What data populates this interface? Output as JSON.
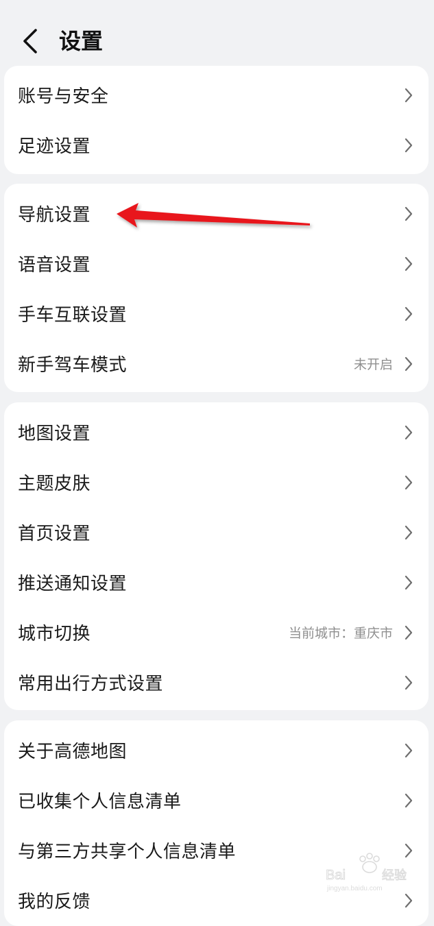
{
  "header": {
    "title": "设置"
  },
  "groups": [
    {
      "items": [
        {
          "label": "账号与安全",
          "value": ""
        },
        {
          "label": "足迹设置",
          "value": ""
        }
      ]
    },
    {
      "items": [
        {
          "label": "导航设置",
          "value": ""
        },
        {
          "label": "语音设置",
          "value": ""
        },
        {
          "label": "手车互联设置",
          "value": ""
        },
        {
          "label": "新手驾车模式",
          "value": "未开启"
        }
      ]
    },
    {
      "items": [
        {
          "label": "地图设置",
          "value": ""
        },
        {
          "label": "主题皮肤",
          "value": ""
        },
        {
          "label": "首页设置",
          "value": ""
        },
        {
          "label": "推送通知设置",
          "value": ""
        },
        {
          "label": "城市切换",
          "value": "当前城市：重庆市"
        },
        {
          "label": "常用出行方式设置",
          "value": ""
        }
      ]
    },
    {
      "items": [
        {
          "label": "关于高德地图",
          "value": ""
        },
        {
          "label": "已收集个人信息清单",
          "value": ""
        },
        {
          "label": "与第三方共享个人信息清单",
          "value": ""
        },
        {
          "label": "我的反馈",
          "value": ""
        }
      ]
    }
  ],
  "icons": {
    "back": "chevron-left-icon",
    "row_arrow": "chevron-right-icon"
  },
  "colors": {
    "background": "#f1f2f4",
    "card": "#ffffff",
    "annotation_arrow": "#e8171b",
    "secondary_text": "#8f8f8f"
  }
}
